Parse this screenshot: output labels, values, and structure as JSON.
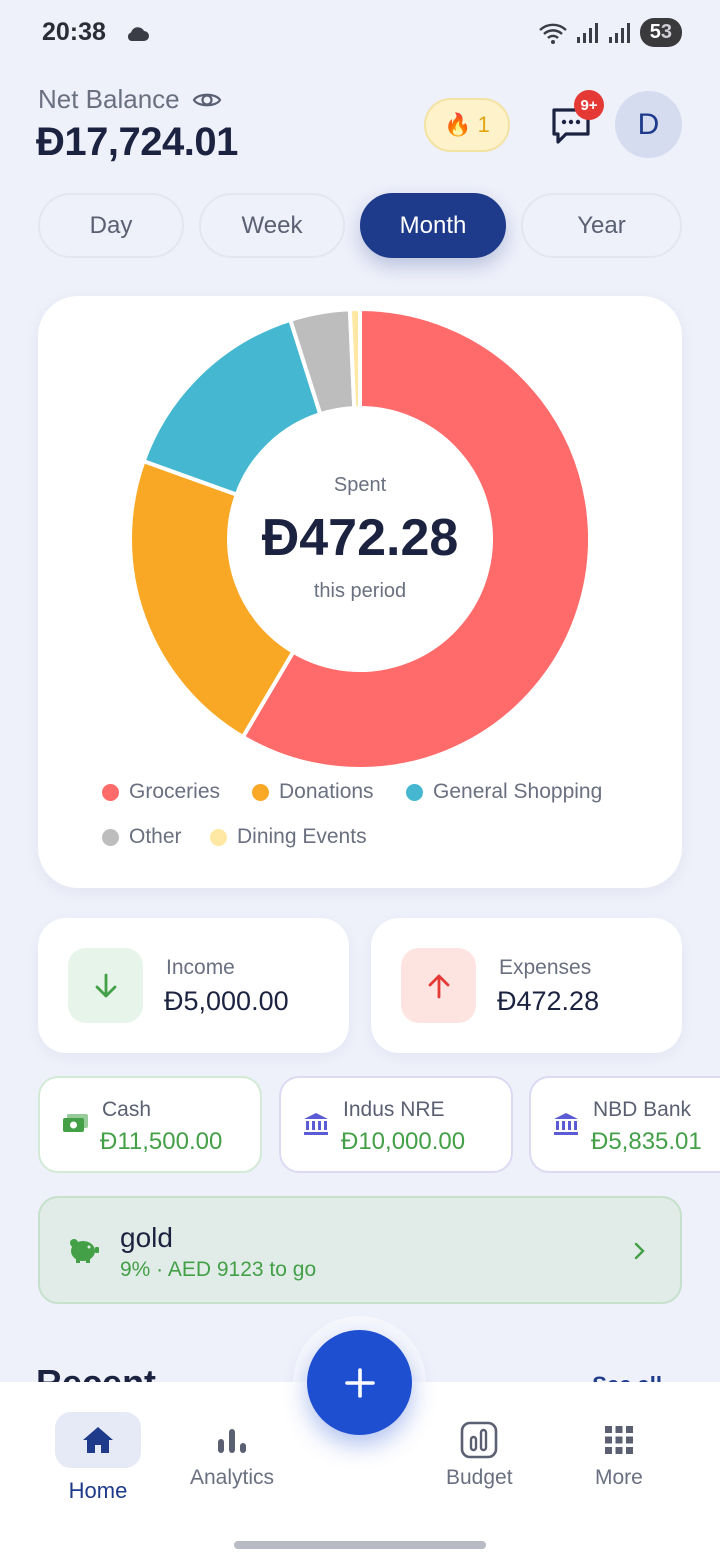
{
  "status": {
    "time": "20:38",
    "battery_a": "5",
    "battery_b": "3"
  },
  "header": {
    "net_label": "Net Balance",
    "net_amount": "Đ17,724.01",
    "streak": "1",
    "badge": "9+",
    "avatar": "D"
  },
  "tabs": [
    "Day",
    "Week",
    "Month",
    "Year"
  ],
  "active_tab": "Month",
  "chart_data": {
    "type": "pie",
    "center": {
      "top": "Spent",
      "amount": "Đ472.28",
      "bottom": "this period"
    },
    "slices": [
      {
        "name": "Groceries",
        "value": 58.5,
        "color": "#ff6b6b"
      },
      {
        "name": "Donations",
        "value": 22.0,
        "color": "#f9a826"
      },
      {
        "name": "General Shopping",
        "value": 14.6,
        "color": "#45b7d1"
      },
      {
        "name": "Other",
        "value": 4.2,
        "color": "#bdbdbd"
      },
      {
        "name": "Dining Events",
        "value": 0.7,
        "color": "#ffe8a3"
      }
    ]
  },
  "summary": {
    "income": {
      "label": "Income",
      "value": "Đ5,000.00",
      "color": "#43a047",
      "bg": "#e6f4ea"
    },
    "expenses": {
      "label": "Expenses",
      "value": "Đ472.28",
      "color": "#e53935",
      "bg": "#fde4e1"
    }
  },
  "accounts": [
    {
      "name": "Cash",
      "balance": "Đ11,500.00",
      "icon": "cash-icon"
    },
    {
      "name": "Indus NRE",
      "balance": "Đ10,000.00",
      "icon": "bank-icon"
    },
    {
      "name": "NBD Bank",
      "balance": "Đ5,835.01",
      "icon": "bank-icon"
    }
  ],
  "goal": {
    "name": "gold",
    "subtitle": "9% · AED 9123 to go",
    "icon": "piggy-bank-icon"
  },
  "recent": {
    "title": "Recent",
    "see_all": "See all"
  },
  "nav": {
    "home": "Home",
    "analytics": "Analytics",
    "budget": "Budget",
    "more": "More"
  }
}
